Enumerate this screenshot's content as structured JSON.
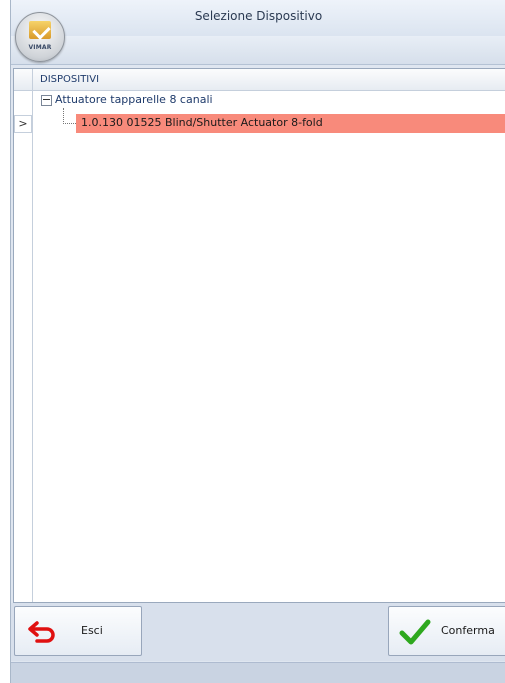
{
  "window": {
    "title": "Selezione Dispositivo"
  },
  "logo": {
    "text": "VIMAR"
  },
  "grid": {
    "column_header": "DISPOSITIVI",
    "rows": [
      {
        "label": "Attuatore tapparelle 8 canali",
        "expanded": true
      },
      {
        "label": "1.0.130 01525 Blind/Shutter Actuator 8-fold",
        "selected": true
      }
    ],
    "row_indicator": ">"
  },
  "footer": {
    "exit_label": "Esci",
    "confirm_label": "Conferma"
  },
  "colors": {
    "selection": "#f88a7b",
    "exit_icon": "#e01010",
    "confirm_icon": "#2ea81e"
  },
  "icons": {
    "exit": "undo-arrow-icon",
    "confirm": "checkmark-icon",
    "expander": "minus-box-icon"
  }
}
